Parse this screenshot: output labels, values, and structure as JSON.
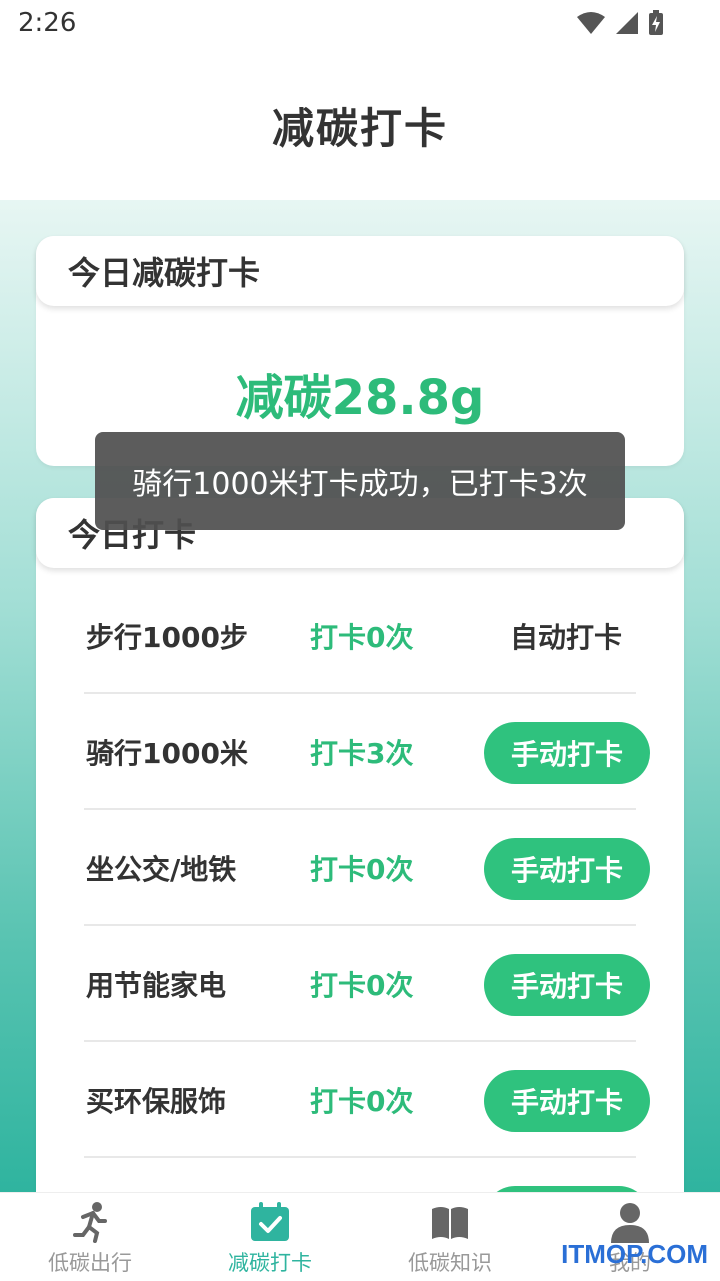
{
  "status_bar": {
    "time": "2:26"
  },
  "header": {
    "title": "减碳打卡"
  },
  "today_card": {
    "title": "今日减碳打卡",
    "value": "减碳28.8g"
  },
  "checkin_card": {
    "title": "今日打卡",
    "rows": [
      {
        "name": "步行1000步",
        "count": "打卡0次",
        "action": "自动打卡"
      },
      {
        "name": "骑行1000米",
        "count": "打卡3次",
        "action": "手动打卡"
      },
      {
        "name": "坐公交/地铁",
        "count": "打卡0次",
        "action": "手动打卡"
      },
      {
        "name": "用节能家电",
        "count": "打卡0次",
        "action": "手动打卡"
      },
      {
        "name": "买环保服饰",
        "count": "打卡0次",
        "action": "手动打卡"
      }
    ]
  },
  "toast": {
    "message": "骑行1000米打卡成功，已打卡3次"
  },
  "bottom_nav": {
    "items": [
      {
        "label": "低碳出行",
        "icon": "running-icon"
      },
      {
        "label": "减碳打卡",
        "icon": "calendar-check-icon",
        "active": true
      },
      {
        "label": "低碳知识",
        "icon": "book-icon"
      },
      {
        "label": "我的",
        "icon": "person-icon"
      }
    ]
  },
  "watermark": "ITMOP.COM",
  "colors": {
    "accent_green": "#2dbb7a",
    "button_green": "#2fc27e",
    "nav_active": "#2fb49f"
  }
}
